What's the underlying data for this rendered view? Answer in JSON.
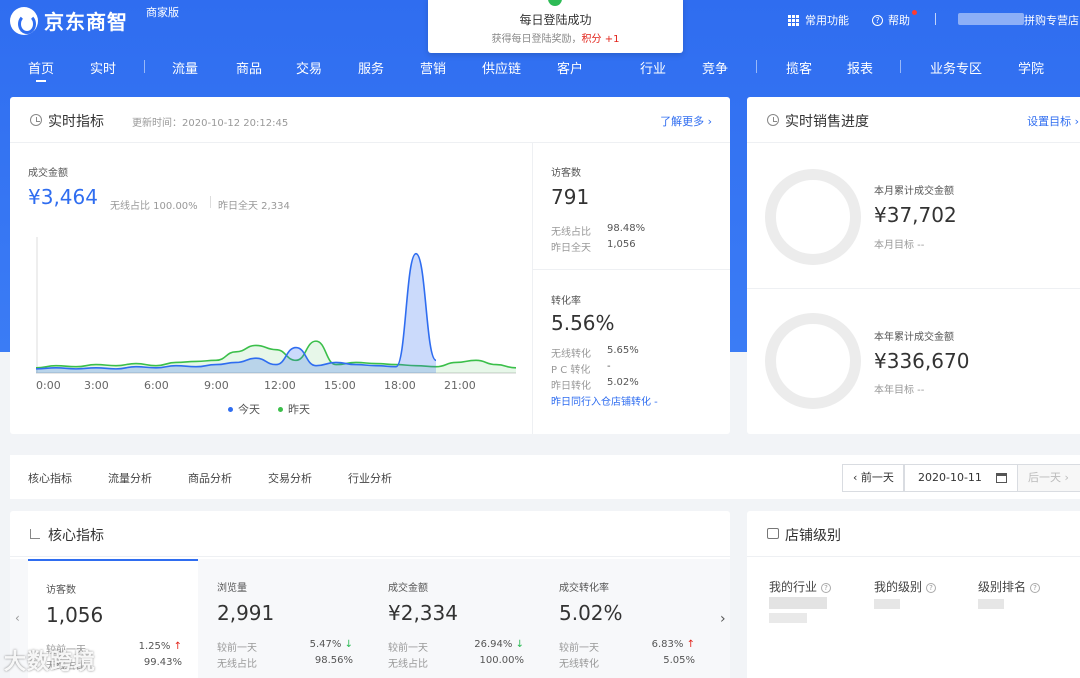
{
  "brand": {
    "name": "京东商智",
    "sub": "商家版"
  },
  "toast": {
    "title": "每日登陆成功",
    "desc_prefix": "获得每日登陆奖励，",
    "desc_highlight": "积分 +1"
  },
  "topbar": {
    "common_functions": "常用功能",
    "help": "帮助",
    "shop_suffix": "拼购专营店"
  },
  "nav": [
    "首页",
    "实时",
    "流量",
    "商品",
    "交易",
    "服务",
    "营销",
    "供应链",
    "客户",
    "行业",
    "竞争",
    "揽客",
    "报表",
    "业务专区",
    "学院"
  ],
  "realtime": {
    "title": "实时指标",
    "updated": "更新时间：2020-10-12 20:12:45",
    "more": "了解更多 ›",
    "gmv_label": "成交金额",
    "gmv_value": "¥3,464",
    "wireless_ratio": "无线占比 100.00%",
    "yesterday_total": "昨日全天 2,334",
    "visitors_label": "访客数",
    "visitors_value": "791",
    "v_wireless_label": "无线占比",
    "v_wireless_value": "98.48%",
    "v_yday_label": "昨日全天",
    "v_yday_value": "1,056",
    "conv_label": "转化率",
    "conv_value": "5.56%",
    "c_wireless_label": "无线转化",
    "c_wireless_value": "5.65%",
    "c_pc_label": "P C 转化",
    "c_pc_value": "-",
    "c_yday_label": "昨日转化",
    "c_yday_value": "5.02%",
    "peer_text": "昨日同行入仓店铺转化 -"
  },
  "chart_data": {
    "type": "line",
    "x_ticks": [
      "0:00",
      "3:00",
      "6:00",
      "9:00",
      "12:00",
      "15:00",
      "18:00",
      "21:00"
    ],
    "series": [
      {
        "name": "今天",
        "color": "#2f6df0",
        "x": [
          0,
          1,
          2,
          3,
          4,
          5,
          6,
          7,
          8,
          9,
          10,
          11,
          12,
          13,
          14,
          15,
          16,
          17,
          18,
          19,
          20
        ],
        "values": [
          2,
          3,
          2,
          3,
          2,
          4,
          3,
          5,
          4,
          6,
          8,
          12,
          6,
          22,
          5,
          8,
          6,
          5,
          4,
          110,
          10
        ]
      },
      {
        "name": "昨天",
        "color": "#3bbf4a",
        "x": [
          0,
          1,
          2,
          3,
          4,
          5,
          6,
          7,
          8,
          9,
          10,
          11,
          12,
          13,
          14,
          15,
          16,
          17,
          18,
          19,
          20,
          21,
          22,
          23,
          24
        ],
        "values": [
          3,
          5,
          4,
          6,
          5,
          7,
          5,
          8,
          9,
          10,
          18,
          24,
          20,
          10,
          28,
          6,
          8,
          7,
          6,
          5,
          4,
          8,
          10,
          6,
          3
        ]
      }
    ],
    "ylim": [
      0,
      120
    ]
  },
  "sales_progress": {
    "title": "实时销售进度",
    "set_target": "设置目标 ›",
    "month_label": "本月累计成交金额",
    "month_value": "¥37,702",
    "month_target": "本月目标 --",
    "year_label": "本年累计成交金额",
    "year_value": "¥336,670",
    "year_target": "本年目标 --"
  },
  "analysis_tabs": [
    "核心指标",
    "流量分析",
    "商品分析",
    "交易分析",
    "行业分析"
  ],
  "date_nav": {
    "prev": "‹ 前一天",
    "date": "2020-10-11",
    "next": "后一天 ›"
  },
  "core": {
    "title": "核心指标",
    "metrics": [
      {
        "title": "访客数",
        "value": "1,056",
        "cmp_label": "较前一天",
        "cmp_value": "1.25%",
        "trend": "↑",
        "sub_label": "无线占比",
        "sub_value": "99.43%"
      },
      {
        "title": "浏览量",
        "value": "2,991",
        "cmp_label": "较前一天",
        "cmp_value": "5.47%",
        "trend": "↓",
        "sub_label": "无线占比",
        "sub_value": "98.56%"
      },
      {
        "title": "成交金额",
        "value": "¥2,334",
        "cmp_label": "较前一天",
        "cmp_value": "26.94%",
        "trend": "↓",
        "sub_label": "无线占比",
        "sub_value": "100.00%"
      },
      {
        "title": "成交转化率",
        "value": "5.02%",
        "cmp_label": "较前一天",
        "cmp_value": "6.83%",
        "trend": "↑",
        "sub_label": "无线转化",
        "sub_value": "5.05%"
      }
    ]
  },
  "shop_level": {
    "title": "店铺级别",
    "cols": [
      "我的行业",
      "我的级别",
      "级别排名"
    ]
  },
  "watermark": "大数跨境"
}
